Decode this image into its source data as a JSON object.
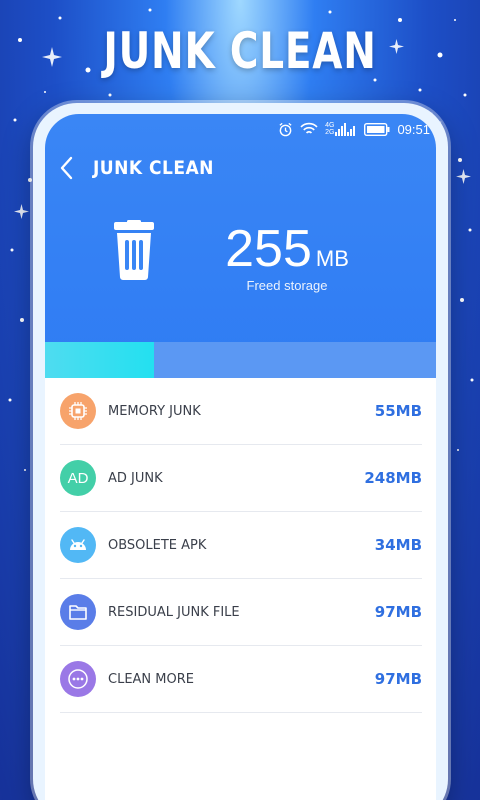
{
  "promo": {
    "title": "JUNK CLEAN"
  },
  "status_bar": {
    "time": "09:51",
    "network": "4G",
    "network2": "2G"
  },
  "app_bar": {
    "title": "JUNK CLEAN"
  },
  "summary": {
    "value": "255",
    "unit": "MB",
    "label": "Freed storage"
  },
  "progress": {
    "fraction": 0.28
  },
  "colors": {
    "accent": "#2f7cf3",
    "progress": "#23e0f0",
    "value_text": "#2f6fe0"
  },
  "junk_items": [
    {
      "label": "MEMORY JUNK",
      "value": "55MB",
      "icon": "chip-icon",
      "icon_color": "#f7a36b"
    },
    {
      "label": "AD JUNK",
      "value": "248MB",
      "icon": "ad-icon",
      "icon_text": "AD",
      "icon_color": "#43cfa8"
    },
    {
      "label": "OBSOLETE APK",
      "value": "34MB",
      "icon": "android-icon",
      "icon_color": "#52b8f5"
    },
    {
      "label": "RESIDUAL JUNK FILE",
      "value": "97MB",
      "icon": "folder-icon",
      "icon_color": "#5a7de8"
    },
    {
      "label": "CLEAN MORE",
      "value": "97MB",
      "icon": "more-icon",
      "icon_color": "#9a78e6"
    }
  ]
}
